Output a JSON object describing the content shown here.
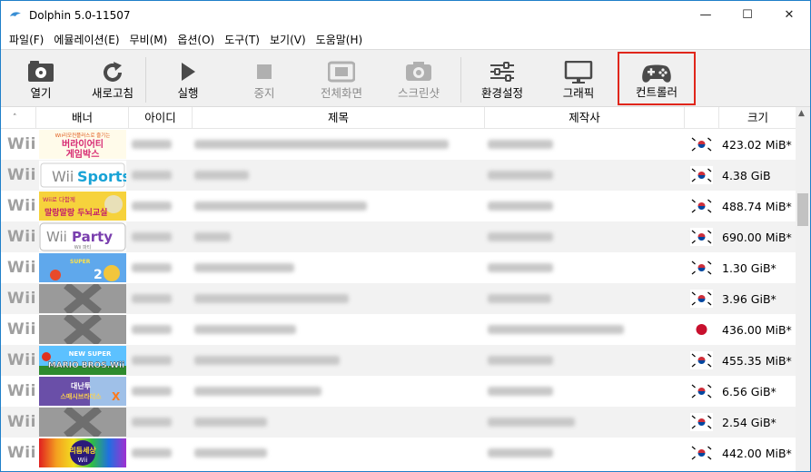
{
  "window": {
    "title": "Dolphin 5.0-11507",
    "minimize": "—",
    "maximize": "☐",
    "close": "✕"
  },
  "menu": [
    "파일(F)",
    "에뮬레이션(E)",
    "무비(M)",
    "옵션(O)",
    "도구(T)",
    "보기(V)",
    "도움말(H)"
  ],
  "toolbar": {
    "open": "열기",
    "refresh": "새로고침",
    "play": "실행",
    "stop": "중지",
    "fullscreen": "전체화면",
    "screenshot": "스크린샷",
    "config": "환경설정",
    "graphics": "그래픽",
    "controllers": "컨트롤러"
  },
  "columns": {
    "banner": "배너",
    "id": "아이디",
    "title": "제목",
    "maker": "제작사",
    "size": "크기"
  },
  "sort_arrow": "˄",
  "rows": [
    {
      "platform": "Wii",
      "banner": "bunch",
      "region": "kr",
      "size": "423.02 MiB*",
      "banner_text": [
        "Wii리모컨플러스로 즐기는",
        "버라이어티",
        "게임박스"
      ]
    },
    {
      "platform": "Wii",
      "banner": "sports",
      "region": "kr",
      "size": "4.38 GiB",
      "banner_text": [
        "Wii",
        "Sports"
      ]
    },
    {
      "platform": "Wii",
      "banner": "brain",
      "region": "kr",
      "size": "488.74 MiB*",
      "banner_text": [
        "Wii로 다함께",
        "말랑말랑 두뇌교실"
      ]
    },
    {
      "platform": "Wii",
      "banner": "party",
      "region": "kr",
      "size": "690.00 MiB*",
      "banner_text": [
        "Wii",
        "Party",
        "Wii 파티"
      ]
    },
    {
      "platform": "Wii",
      "banner": "galaxy",
      "region": "kr",
      "size": "1.30 GiB*",
      "banner_text": [
        "SUPER",
        "2"
      ]
    },
    {
      "platform": "Wii",
      "banner": "none",
      "region": "kr",
      "size": "3.96 GiB*",
      "banner_text": []
    },
    {
      "platform": "Wii",
      "banner": "none",
      "region": "jp",
      "size": "436.00 MiB*",
      "banner_text": []
    },
    {
      "platform": "Wii",
      "banner": "mario",
      "region": "kr",
      "size": "455.35 MiB*",
      "banner_text": [
        "NEW SUPER",
        "MARIO BROS.Wii"
      ]
    },
    {
      "platform": "Wii",
      "banner": "smash",
      "region": "kr",
      "size": "6.56 GiB*",
      "banner_text": [
        "대난투",
        "스매시브라더스",
        "X"
      ]
    },
    {
      "platform": "Wii",
      "banner": "none",
      "region": "kr",
      "size": "2.54 GiB*",
      "banner_text": []
    },
    {
      "platform": "Wii",
      "banner": "rainbow",
      "region": "kr",
      "size": "442.00 MiB*",
      "banner_text": [
        "리듬세상",
        "Wii"
      ]
    }
  ],
  "colors": {
    "accent_border": "#e0261b",
    "window_border": "#1f7fc9",
    "alt_row": "#f2f2f2"
  }
}
